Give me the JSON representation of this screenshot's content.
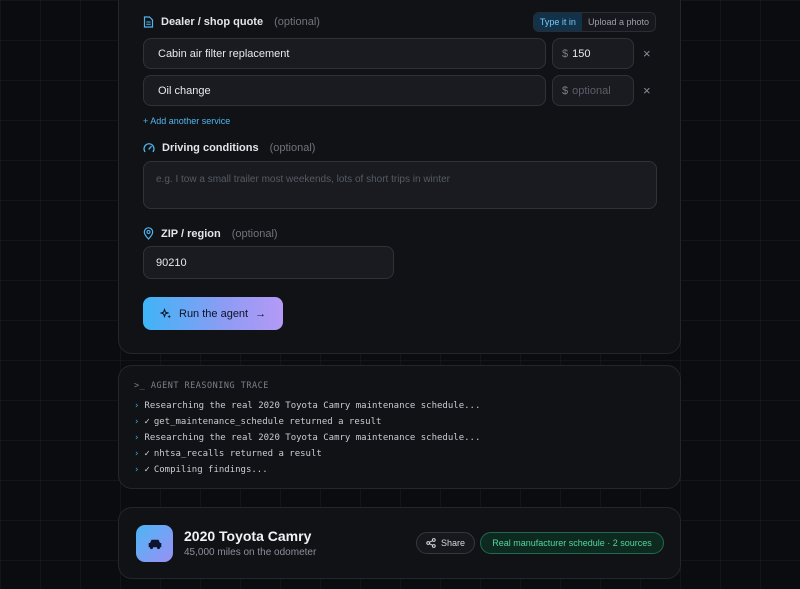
{
  "form": {
    "quote": {
      "label": "Dealer / shop quote",
      "optional": "(optional)",
      "toggle": {
        "type_it_in": "Type it in",
        "upload_photo": "Upload a photo",
        "selected": "Type it in"
      },
      "rows": [
        {
          "service": "Cabin air filter replacement",
          "currency": "$",
          "price": "150",
          "price_placeholder": "optional",
          "remove": "×"
        },
        {
          "service": "Oil change",
          "currency": "$",
          "price": "",
          "price_placeholder": "optional",
          "remove": "×"
        }
      ],
      "add_service": "+ Add another service"
    },
    "driving": {
      "label": "Driving conditions",
      "optional": "(optional)",
      "placeholder": "e.g. I tow a small trailer most weekends, lots of short trips in winter"
    },
    "zip": {
      "label": "ZIP / region",
      "optional": "(optional)",
      "value": "90210"
    },
    "run_button": {
      "label": "Run the agent",
      "arrow": "→"
    }
  },
  "trace": {
    "title": ">_ AGENT REASONING TRACE",
    "caret": "›",
    "check": "✓",
    "lines": [
      {
        "done": false,
        "text": "Researching the real 2020 Toyota Camry maintenance schedule..."
      },
      {
        "done": true,
        "text": "get_maintenance_schedule returned a result"
      },
      {
        "done": false,
        "text": "Researching the real 2020 Toyota Camry maintenance schedule..."
      },
      {
        "done": true,
        "text": "nhtsa_recalls returned a result"
      },
      {
        "done": true,
        "text": "Compiling findings..."
      }
    ]
  },
  "vehicle": {
    "title": "2020 Toyota Camry",
    "subtitle": "45,000 miles on the odometer",
    "share_label": "Share",
    "badge": "Real manufacturer schedule · 2 sources"
  },
  "colors": {
    "accent": "#3fb4f6",
    "accent_end": "#b49af6",
    "badge_green": "#52d69c",
    "card_bg": "#111216"
  }
}
